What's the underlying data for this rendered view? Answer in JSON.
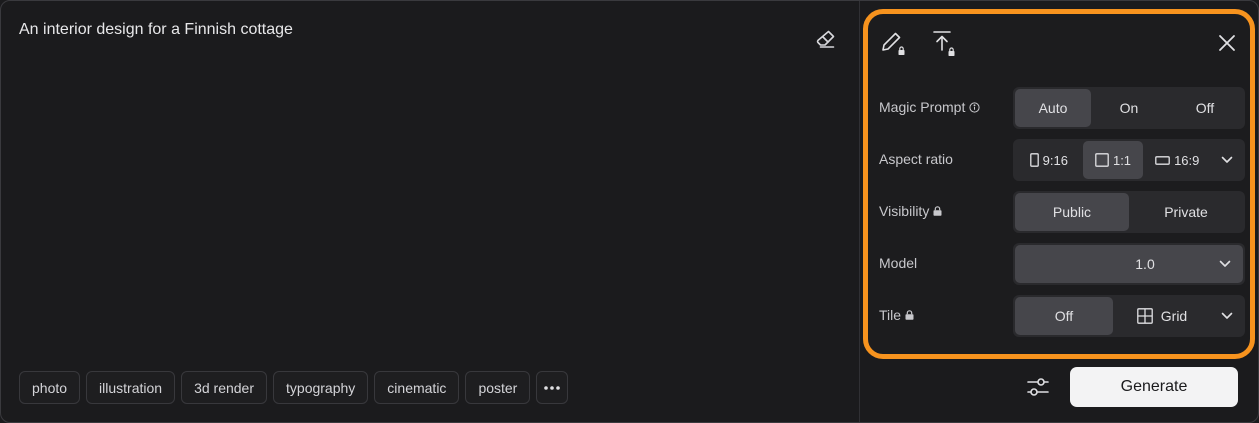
{
  "prompt": {
    "text": "An interior design for a Finnish cottage"
  },
  "tags": [
    "photo",
    "illustration",
    "3d render",
    "typography",
    "cinematic",
    "poster"
  ],
  "icons": {
    "eraser": "eraser-icon",
    "edit": "pencil-lock-icon",
    "upload": "upload-lock-icon",
    "close": "close-icon",
    "more": "more-dots-icon",
    "settings": "sliders-icon"
  },
  "panel": {
    "magic_prompt": {
      "label": "Magic Prompt",
      "options": [
        "Auto",
        "On",
        "Off"
      ],
      "selected": "Auto"
    },
    "aspect_ratio": {
      "label": "Aspect ratio",
      "options": [
        "9:16",
        "1:1",
        "16:9"
      ],
      "selected": "1:1"
    },
    "visibility": {
      "label": "Visibility",
      "options": [
        "Public",
        "Private"
      ],
      "selected": "Public"
    },
    "model": {
      "label": "Model",
      "value": "1.0"
    },
    "tile": {
      "label": "Tile",
      "options": [
        "Off",
        "Grid"
      ],
      "selected": "Off"
    }
  },
  "actions": {
    "generate": "Generate"
  },
  "colors": {
    "highlight": "#f7931e",
    "background": "#1b1b1d",
    "segment_bg": "#2a2a2d",
    "segment_selected": "#46464b",
    "generate_bg": "#f3f3f4"
  }
}
